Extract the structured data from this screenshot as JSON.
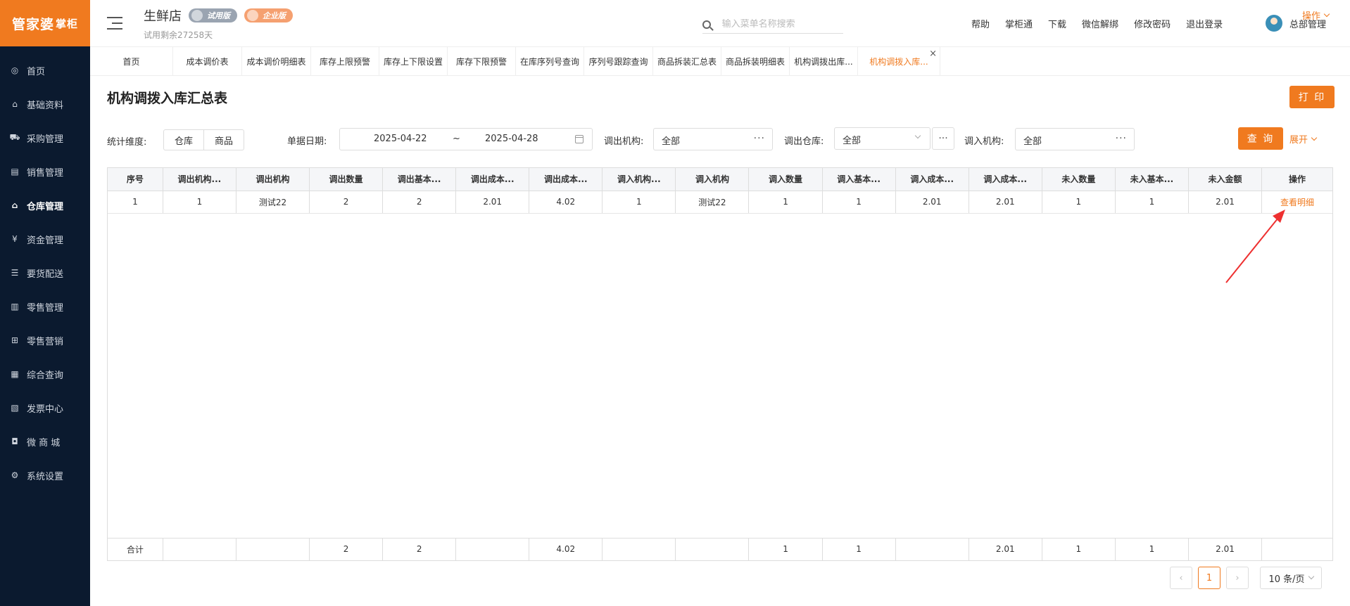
{
  "logo": {
    "brand": "管家婆",
    "sub": "掌柜"
  },
  "sidebar": {
    "items": [
      {
        "label": "首页",
        "icon": "globe-icon",
        "glyph": "◎"
      },
      {
        "label": "基础资料",
        "icon": "home-icon",
        "glyph": "⌂"
      },
      {
        "label": "采购管理",
        "icon": "cart-icon",
        "glyph": "⛟"
      },
      {
        "label": "销售管理",
        "icon": "sales-icon",
        "glyph": "▤"
      },
      {
        "label": "仓库管理",
        "icon": "warehouse-icon",
        "glyph": "⌂",
        "active": true
      },
      {
        "label": "资金管理",
        "icon": "yuan-icon",
        "glyph": "¥"
      },
      {
        "label": "要货配送",
        "icon": "delivery-icon",
        "glyph": "☰"
      },
      {
        "label": "零售管理",
        "icon": "retail-chart-icon",
        "glyph": "▥"
      },
      {
        "label": "零售营销",
        "icon": "gift-icon",
        "glyph": "⊞"
      },
      {
        "label": "综合查询",
        "icon": "bar-chart-icon",
        "glyph": "▦"
      },
      {
        "label": "发票中心",
        "icon": "invoice-icon",
        "glyph": "▧"
      },
      {
        "label": "微 商 城",
        "icon": "shop-bag-icon",
        "glyph": "◘"
      },
      {
        "label": "系统设置",
        "icon": "gear-icon",
        "glyph": "⚙"
      }
    ]
  },
  "header": {
    "store_name": "生鲜店",
    "badge_trial": "试用版",
    "badge_enterprise": "企业版",
    "remaining": "试用剩余27258天",
    "search_placeholder": "输入菜单名称搜索",
    "links": [
      "帮助",
      "掌柜通",
      "下载",
      "微信解绑",
      "修改密码",
      "退出登录"
    ],
    "user": "总部管理"
  },
  "tabs": {
    "items": [
      {
        "label": "首页",
        "w": 118
      },
      {
        "label": "成本调价表",
        "w": 98
      },
      {
        "label": "成本调价明细表",
        "w": 98
      },
      {
        "label": "库存上限预警",
        "w": 97
      },
      {
        "label": "库存上下限设置",
        "w": 97
      },
      {
        "label": "库存下限预警",
        "w": 97
      },
      {
        "label": "在库序列号查询",
        "w": 97
      },
      {
        "label": "序列号跟踪查询",
        "w": 98
      },
      {
        "label": "商品拆装汇总表",
        "w": 97
      },
      {
        "label": "商品拆装明细表",
        "w": 97
      },
      {
        "label": "机构调拨出库...",
        "w": 97
      },
      {
        "label": "机构调拨入库...",
        "w": 117,
        "active": true
      }
    ],
    "operation": "操作"
  },
  "page": {
    "title": "机构调拨入库汇总表",
    "print": "打 印",
    "query": "查 询",
    "expand": "展开"
  },
  "filters": {
    "dimension_label": "统计维度:",
    "dimension_options": [
      "仓库",
      "商品"
    ],
    "date_label": "单据日期:",
    "date_start": "2025-04-22",
    "date_sep": "~",
    "date_end": "2025-04-28",
    "out_org_label": "调出机构:",
    "out_org_value": "全部",
    "out_wh_label": "调出仓库:",
    "out_wh_value": "全部",
    "in_org_label": "调入机构:",
    "in_org_value": "全部"
  },
  "table": {
    "columns": [
      "序号",
      "调出机构...",
      "调出机构",
      "调出数量",
      "调出基本...",
      "调出成本...",
      "调出成本...",
      "调入机构...",
      "调入机构",
      "调入数量",
      "调入基本...",
      "调入成本...",
      "调入成本...",
      "未入数量",
      "未入基本...",
      "未入金额",
      "操作"
    ],
    "rows": [
      [
        "1",
        "1",
        "测试22",
        "2",
        "2",
        "2.01",
        "4.02",
        "1",
        "测试22",
        "1",
        "1",
        "2.01",
        "2.01",
        "1",
        "1",
        "2.01",
        "查看明细"
      ]
    ],
    "footer": [
      "合计",
      "",
      "",
      "2",
      "2",
      "",
      "4.02",
      "",
      "",
      "1",
      "1",
      "",
      "2.01",
      "1",
      "1",
      "2.01",
      ""
    ]
  },
  "pagination": {
    "current": "1",
    "page_size": "10 条/页"
  },
  "colors": {
    "accent": "#f07a1f",
    "sidebar": "#0b1a2f",
    "arrow": "#ee3030"
  }
}
